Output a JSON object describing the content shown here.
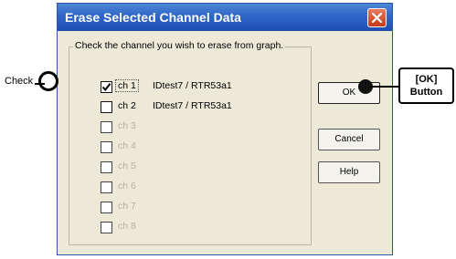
{
  "dialog": {
    "title": "Erase Selected Channel Data",
    "instruction": "Check the channel you wish to erase from graph.",
    "channels": [
      {
        "label": "ch 1",
        "desc": "IDtest7  / RTR53a1",
        "checked": true,
        "enabled": true
      },
      {
        "label": "ch 2",
        "desc": "IDtest7  / RTR53a1",
        "checked": false,
        "enabled": true
      },
      {
        "label": "ch 3",
        "desc": "",
        "checked": false,
        "enabled": false
      },
      {
        "label": "ch 4",
        "desc": "",
        "checked": false,
        "enabled": false
      },
      {
        "label": "ch 5",
        "desc": "",
        "checked": false,
        "enabled": false
      },
      {
        "label": "ch 6",
        "desc": "",
        "checked": false,
        "enabled": false
      },
      {
        "label": "ch 7",
        "desc": "",
        "checked": false,
        "enabled": false
      },
      {
        "label": "ch 8",
        "desc": "",
        "checked": false,
        "enabled": false
      }
    ],
    "buttons": {
      "ok": "OK",
      "cancel": "Cancel",
      "help": "Help"
    }
  },
  "annotations": {
    "check_label": "Check",
    "ok_callout_line1": "[OK]",
    "ok_callout_line2": "Button"
  },
  "icons": {
    "close": "close-x-icon",
    "checkmark": "checkmark-icon"
  },
  "colors": {
    "title_bar": "#2f66c7",
    "close_button": "#c43a1b",
    "dialog_bg": "#ece9d8"
  }
}
